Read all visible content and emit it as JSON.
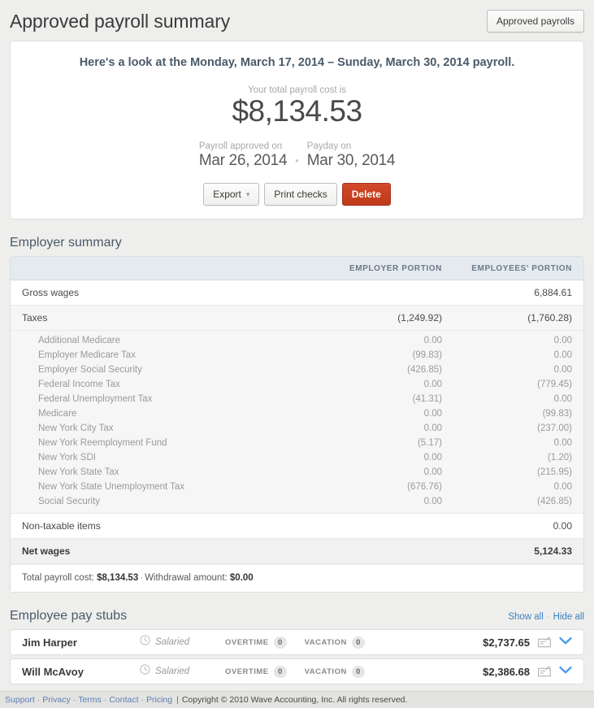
{
  "header": {
    "title": "Approved payroll summary",
    "approved_payrolls_button": "Approved payrolls"
  },
  "hero": {
    "headline": "Here's a look at the Monday, March 17, 2014 – Sunday, March 30, 2014 payroll.",
    "total_label": "Your total payroll cost is",
    "total_amount": "$8,134.53",
    "approved_label": "Payroll approved on",
    "approved_date": "Mar 26, 2014",
    "separator": "•",
    "payday_label": "Payday on",
    "payday_date": "Mar 30, 2014",
    "export_button": "Export",
    "export_caret": "▾",
    "print_checks_button": "Print checks",
    "delete_button": "Delete"
  },
  "employer_summary": {
    "section_title": "Employer summary",
    "columns": {
      "label": "",
      "employer_portion": "EMPLOYER PORTION",
      "employees_portion": "EMPLOYEES' PORTION"
    },
    "rows": [
      {
        "label": "Gross wages",
        "employer": "",
        "employees": "6,884.61"
      },
      {
        "label": "Taxes",
        "employer": "(1,249.92)",
        "employees": "(1,760.28)"
      }
    ],
    "tax_details": [
      {
        "label": "Additional Medicare",
        "employer": "0.00",
        "employees": "0.00"
      },
      {
        "label": "Employer Medicare Tax",
        "employer": "(99.83)",
        "employees": "0.00"
      },
      {
        "label": "Employer Social Security",
        "employer": "(426.85)",
        "employees": "0.00"
      },
      {
        "label": "Federal Income Tax",
        "employer": "0.00",
        "employees": "(779.45)"
      },
      {
        "label": "Federal Unemployment Tax",
        "employer": "(41.31)",
        "employees": "0.00"
      },
      {
        "label": "Medicare",
        "employer": "0.00",
        "employees": "(99.83)"
      },
      {
        "label": "New York City Tax",
        "employer": "0.00",
        "employees": "(237.00)"
      },
      {
        "label": "New York Reemployment Fund",
        "employer": "(5.17)",
        "employees": "0.00"
      },
      {
        "label": "New York SDI",
        "employer": "0.00",
        "employees": "(1.20)"
      },
      {
        "label": "New York State Tax",
        "employer": "0.00",
        "employees": "(215.95)"
      },
      {
        "label": "New York State Unemployment Tax",
        "employer": "(676.76)",
        "employees": "0.00"
      },
      {
        "label": "Social Security",
        "employer": "0.00",
        "employees": "(426.85)"
      }
    ],
    "non_taxable": {
      "label": "Non-taxable items",
      "employer": "",
      "employees": "0.00"
    },
    "net_wages": {
      "label": "Net wages",
      "employer": "",
      "employees": "5,124.33"
    },
    "footer": {
      "total_label": "Total payroll cost:",
      "total_value": "$8,134.53",
      "dot": "·",
      "withdrawal_label": "Withdrawal amount:",
      "withdrawal_value": "$0.00"
    }
  },
  "pay_stubs": {
    "section_title": "Employee pay stubs",
    "show_all": "Show all",
    "hide_all": "Hide all",
    "dot": "·",
    "labels": {
      "overtime": "OVERTIME",
      "vacation": "VACATION"
    },
    "employees": [
      {
        "name": "Jim Harper",
        "type": "Salaried",
        "overtime": "0",
        "vacation": "0",
        "amount": "$2,737.65"
      },
      {
        "name": "Will McAvoy",
        "type": "Salaried",
        "overtime": "0",
        "vacation": "0",
        "amount": "$2,386.68"
      }
    ]
  },
  "footer": {
    "links": [
      "Support",
      "Privacy",
      "Terms",
      "Contact",
      "Pricing"
    ],
    "separator": "·",
    "bar": "|",
    "copyright": "Copyright © 2010 Wave Accounting, Inc. All rights reserved."
  },
  "colors": {
    "accent_link": "#3c7fc1",
    "danger": "#bf3a18",
    "heading": "#4b5a69",
    "page_bg": "#eeeeec"
  }
}
